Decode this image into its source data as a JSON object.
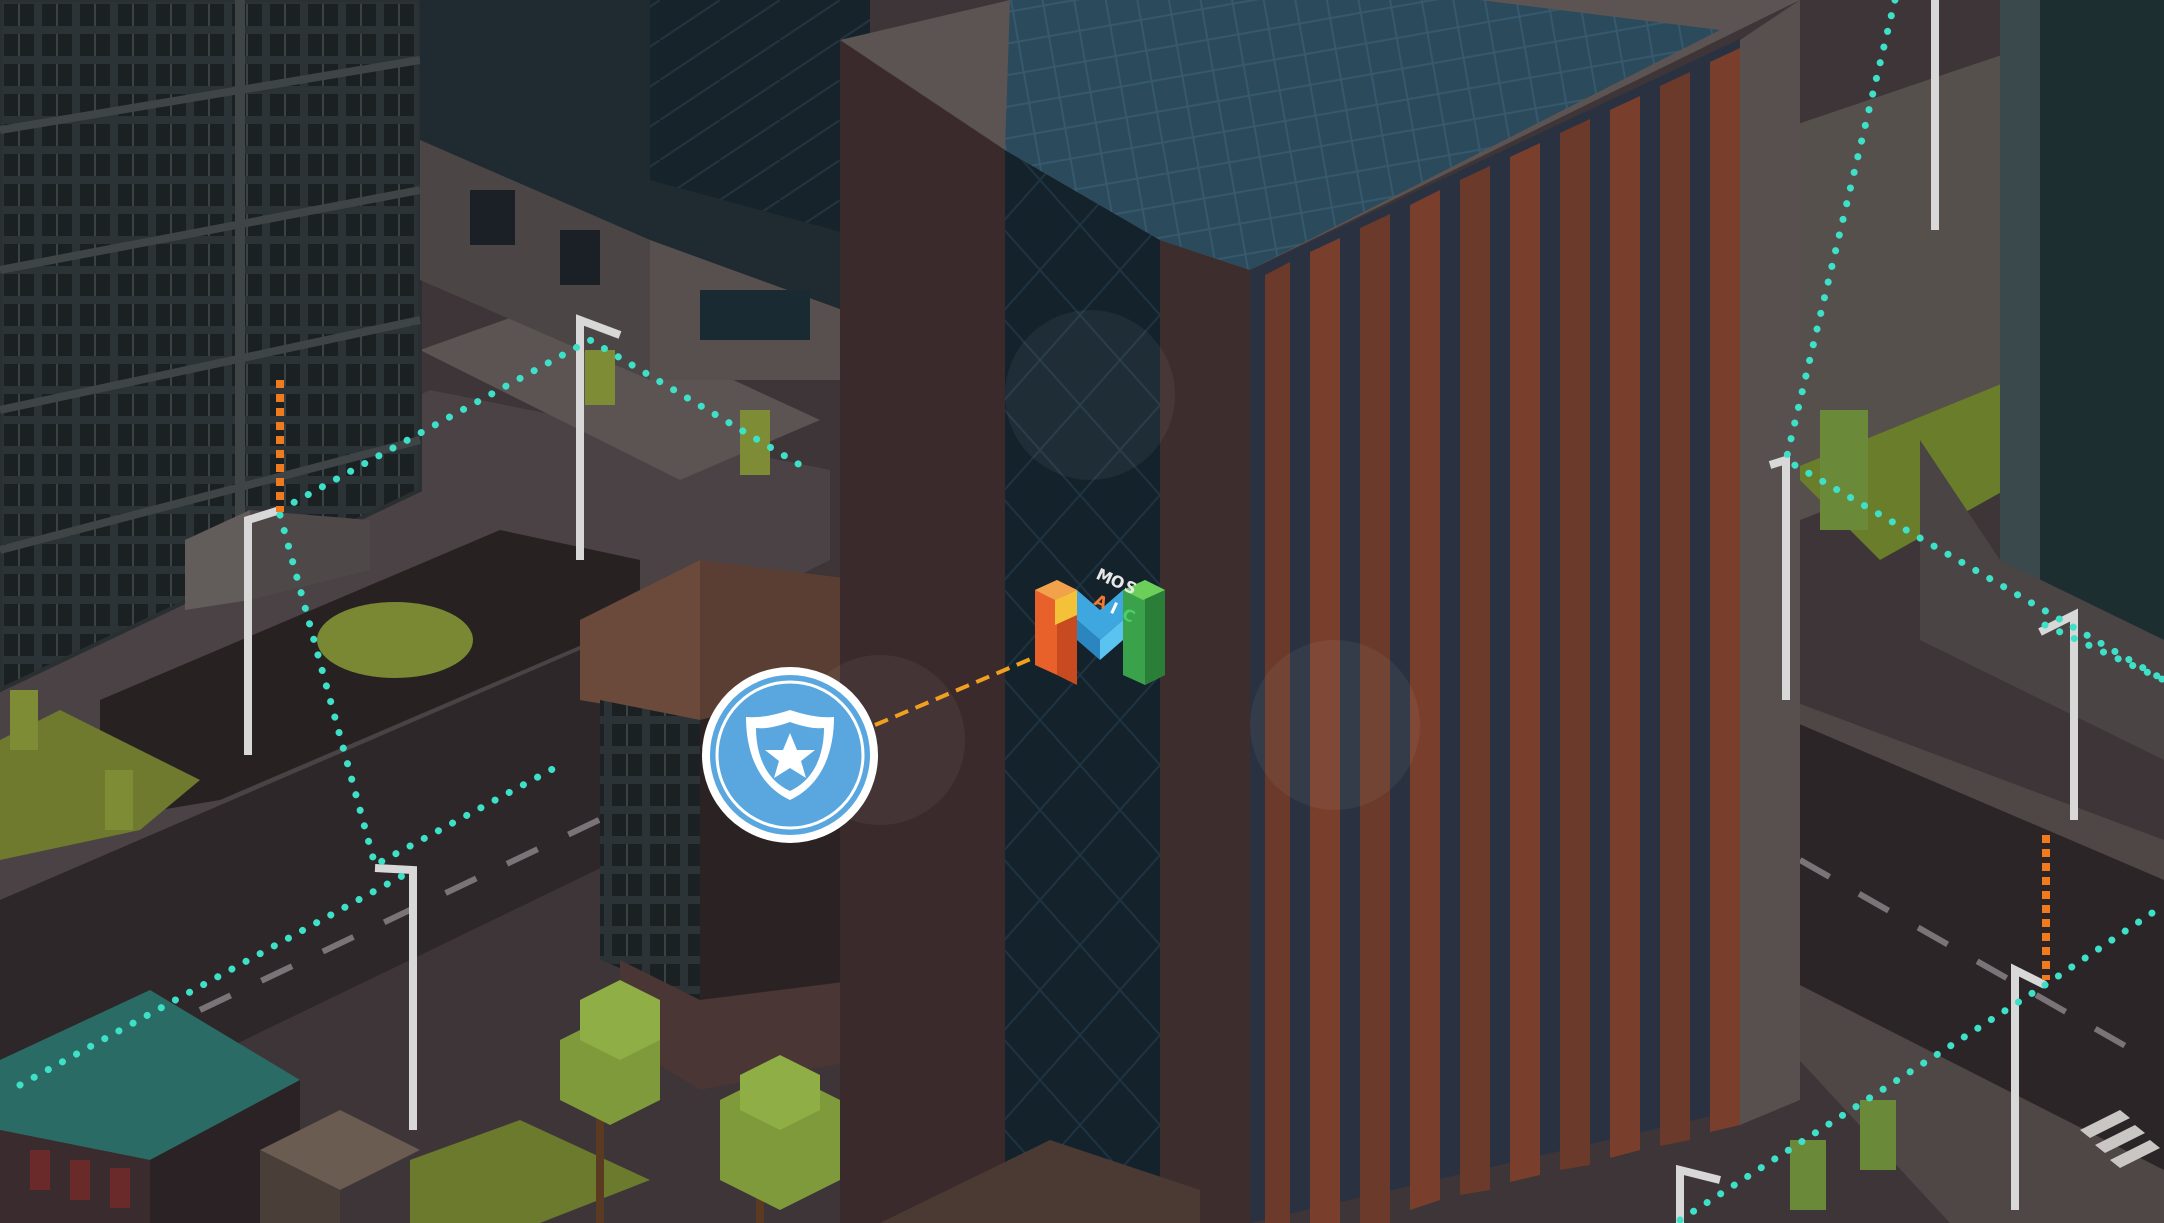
{
  "scene": {
    "logo": {
      "letters": [
        "M",
        "O",
        "S",
        "A",
        "I",
        "C"
      ]
    },
    "icons": {
      "central_badge": "police-shield-star-icon",
      "logo": "mosaic-m-logo-icon"
    },
    "colors": {
      "network_link": "#3fe0c8",
      "uplink": "#f07a1e",
      "badge_link": "#f0a020",
      "badge_fill": "#5aa7e0",
      "badge_ring": "#ffffff",
      "ground": "#3a3335",
      "road": "#2c2628",
      "tower_facade": "#3b2c2c",
      "tower_roof": "#2a4556",
      "glass_wall": "#142633"
    }
  }
}
